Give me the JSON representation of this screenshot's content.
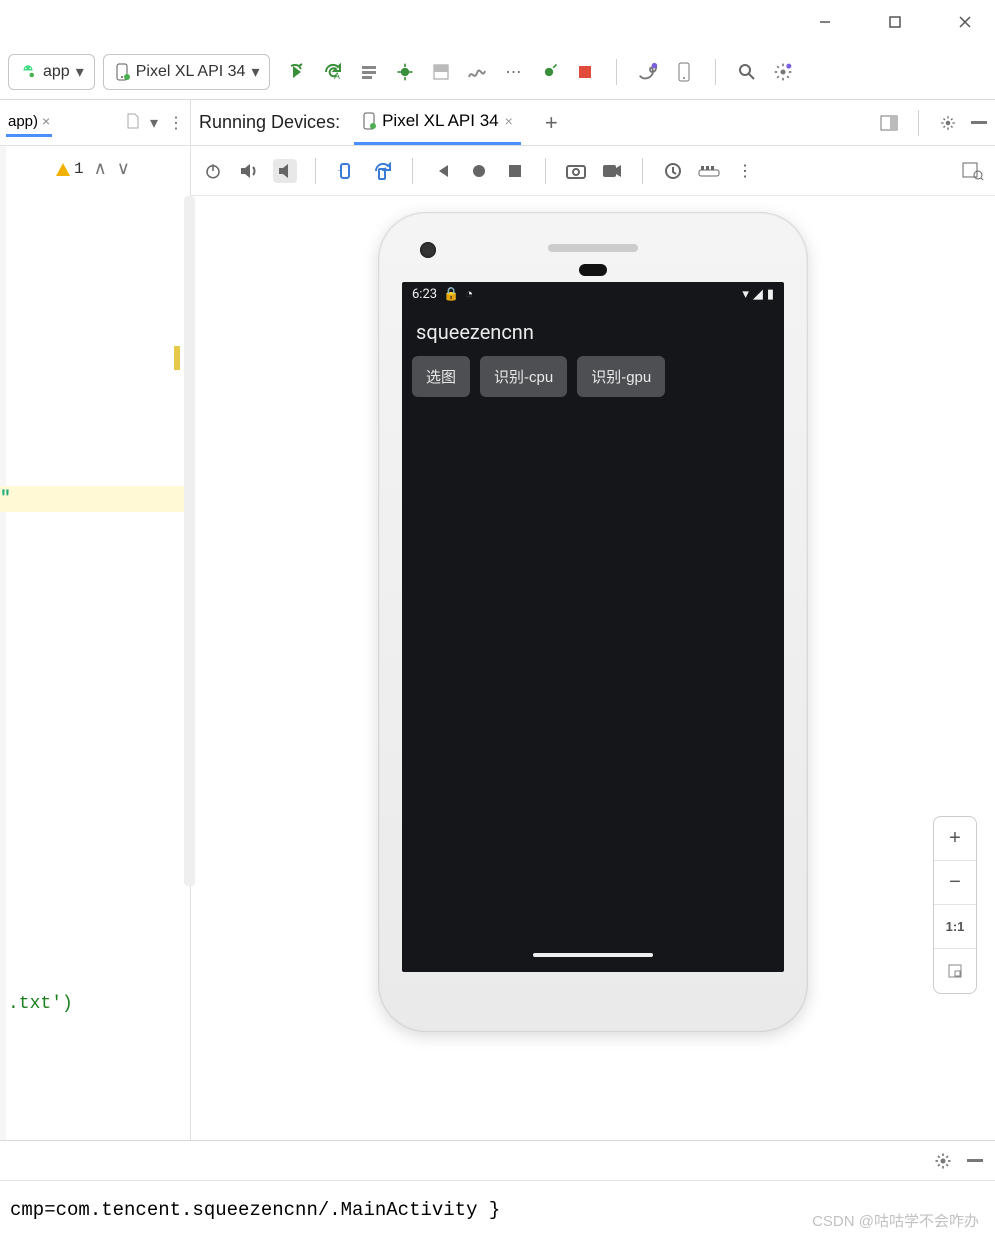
{
  "window": {
    "buttons": [
      "minimize",
      "maximize",
      "close"
    ]
  },
  "toolbar": {
    "modules": {
      "app_label": "app"
    },
    "device_selector": "Pixel XL API 34"
  },
  "left": {
    "tab_label": "app)",
    "warning_count": "1",
    "code_quote": "\"",
    "code_snippet": ".txt')"
  },
  "running_devices": {
    "header_label": "Running Devices:",
    "tab_label": "Pixel XL API 34"
  },
  "emulator": {
    "status_time": "6:23",
    "app_title": "squeezencnn",
    "buttons": [
      "选图",
      "识别-cpu",
      "识别-gpu"
    ]
  },
  "zoom": {
    "one_to_one": "1:1"
  },
  "console": {
    "line": "cmp=com.tencent.squeezencnn/.MainActivity }"
  },
  "watermark": "CSDN @咕咕学不会咋办"
}
